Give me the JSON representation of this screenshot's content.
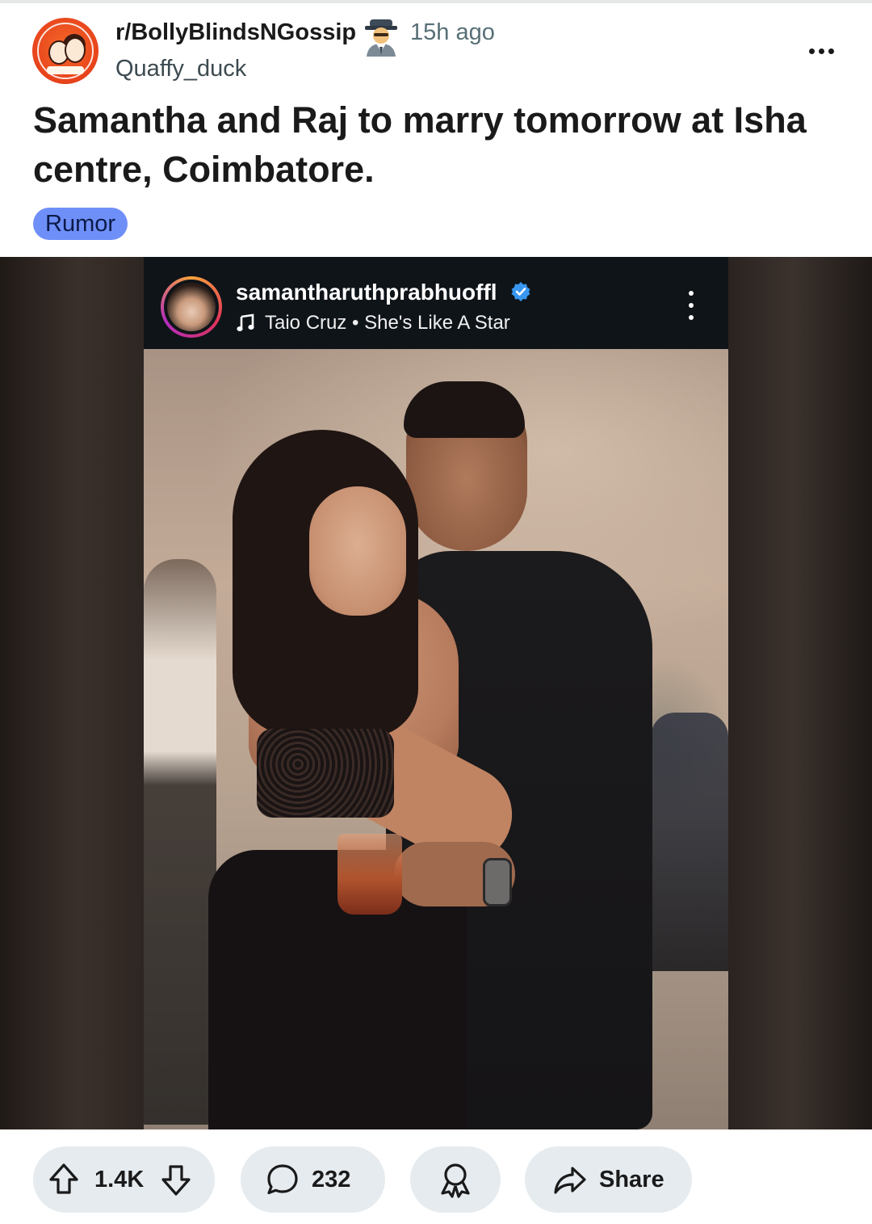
{
  "post": {
    "subreddit": "r/BollyBlindsNGossip",
    "time_ago": "15h ago",
    "author": "Quaffy_duck",
    "title": "Samantha and Raj to marry tomorrow at Isha centre, Coimbatore.",
    "flair": "Rumor",
    "flair_color": "#6f8ff8"
  },
  "embed": {
    "username": "samantharuthprabhuoffl",
    "song": "Taio Cruz • She's Like A Star",
    "verified_color": "#3897f0"
  },
  "actions": {
    "vote_count": "1.4K",
    "comment_count": "232",
    "share_label": "Share"
  },
  "icons": {
    "more": "more-horizontal-icon",
    "embed_more": "more-vertical-icon",
    "music": "music-note-icon",
    "verified": "verified-badge-icon",
    "upvote": "arrow-up-icon",
    "downvote": "arrow-down-icon",
    "comment": "speech-bubble-icon",
    "award": "award-ribbon-icon",
    "share": "share-arrow-icon",
    "flair_emoji": "detective-emoji-icon"
  }
}
